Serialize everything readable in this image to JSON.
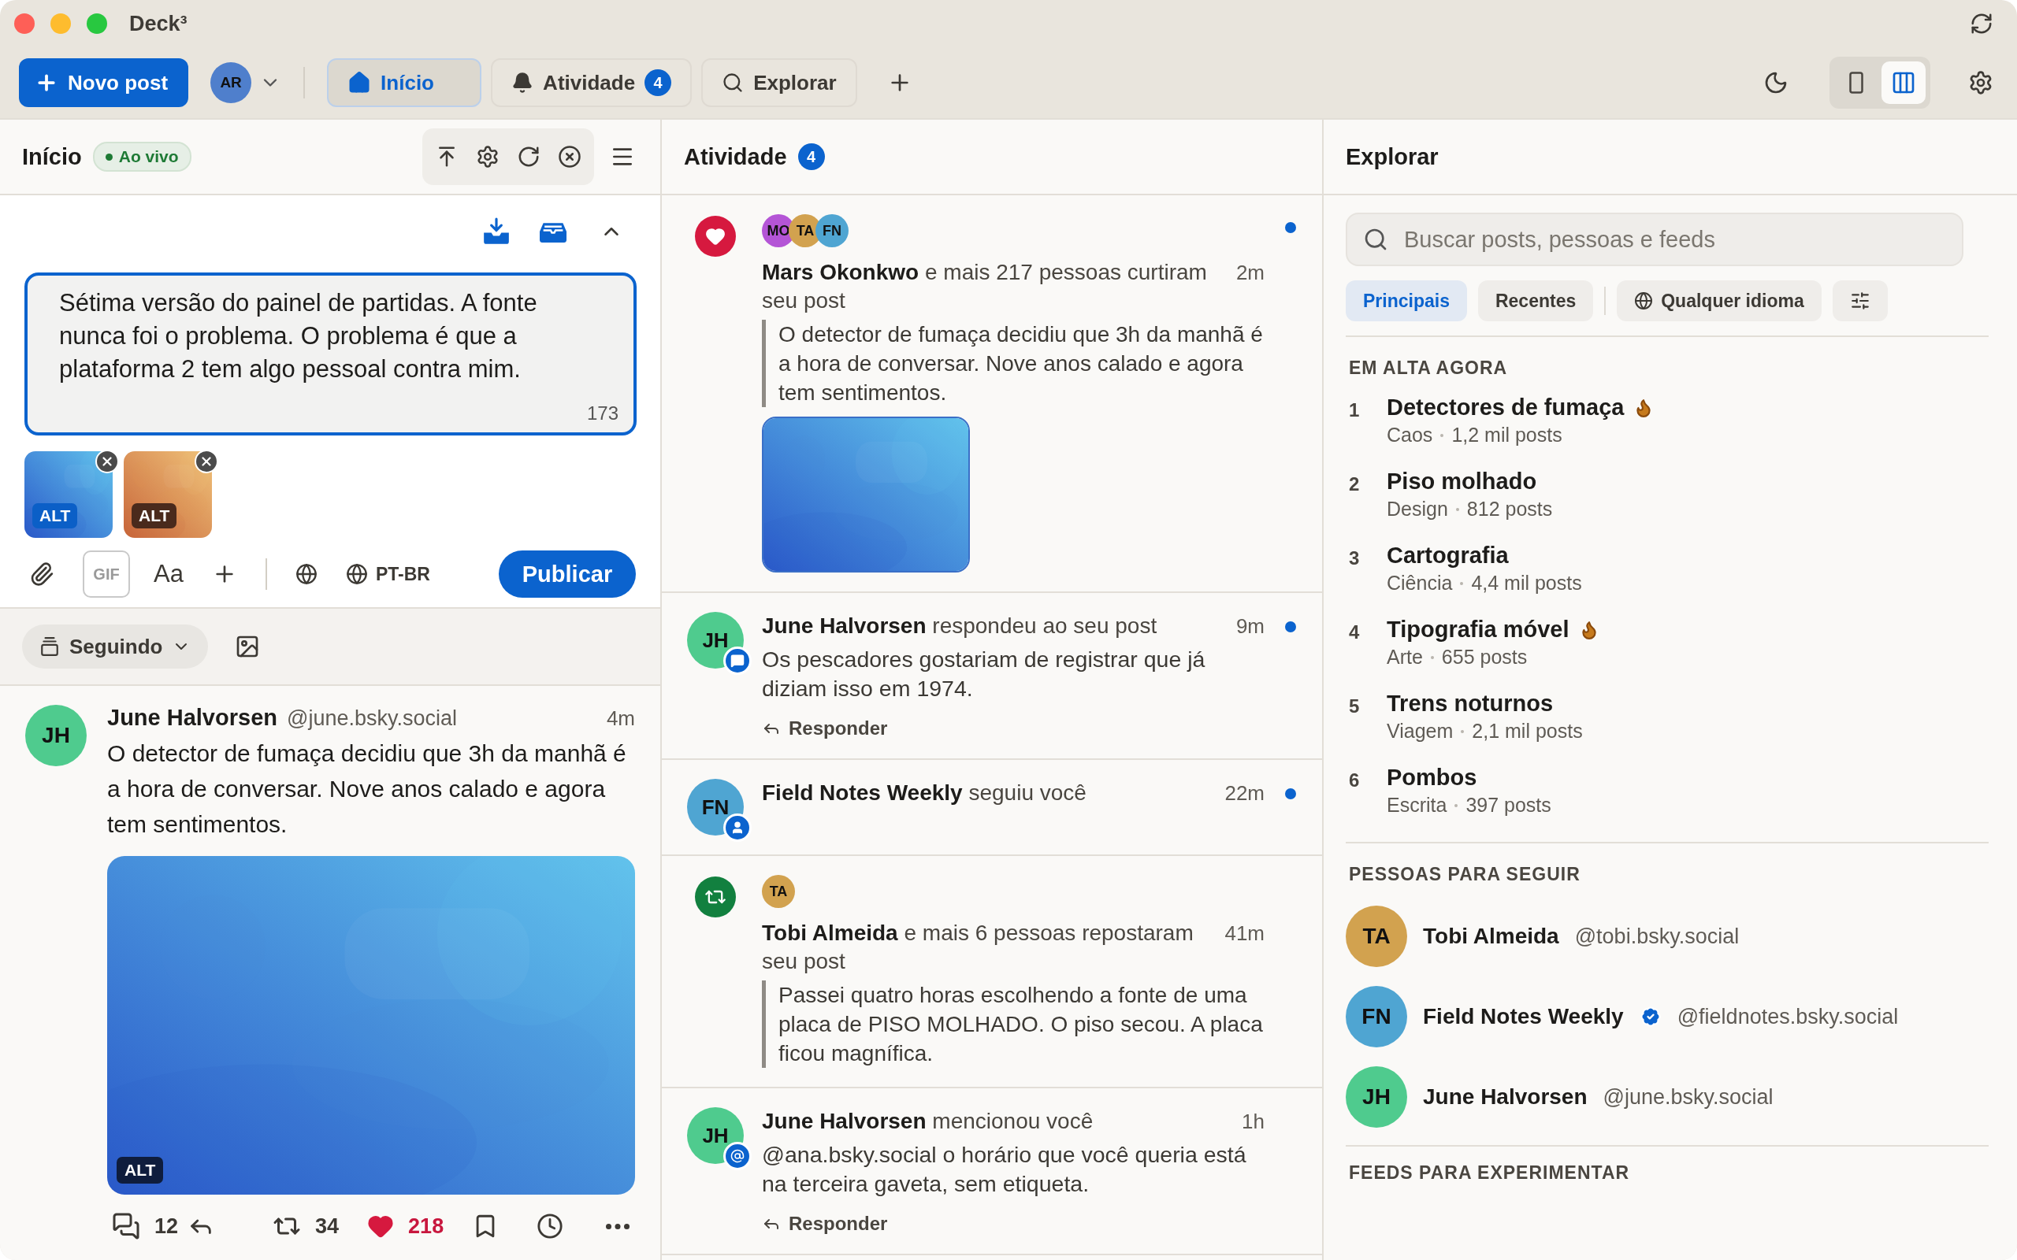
{
  "window": {
    "title": "Deck³"
  },
  "toolbar": {
    "new_post": "Novo post",
    "account": {
      "initials": "AR",
      "color": "#4f7fcc"
    },
    "tabs": [
      {
        "label": "Início",
        "selected": true
      },
      {
        "label": "Atividade",
        "badge": "4",
        "selected": false
      },
      {
        "label": "Explorar",
        "selected": false
      }
    ],
    "layouts": [
      {
        "kind": "single",
        "selected": false
      },
      {
        "kind": "columns",
        "selected": true
      }
    ]
  },
  "home": {
    "title": "Início",
    "live": "Ao vivo",
    "composer": {
      "value": "Sétima versão do painel de partidas. A fonte nunca foi o problema. O problema é que a plataforma 2 tem algo pessoal contra mim.",
      "count": "173",
      "attachments": [
        {
          "alt": "ALT",
          "color": "#0b5fc7"
        },
        {
          "alt": "ALT",
          "color": "#4a2a1c"
        }
      ],
      "gif": "GIF",
      "font": "Aa",
      "language": "PT-BR",
      "publish": "Publicar"
    },
    "filter": "Seguindo",
    "posts": [
      {
        "initials": "JH",
        "color": "#4fcb8e",
        "name": "June Halvorsen",
        "handle": "@june.bsky.social",
        "time": "4m",
        "text": "O detector de fumaça decidiu que 3h da manhã é a hora de conversar. Nove anos calado e agora tem sentimentos.",
        "image_alt": "ALT",
        "replies": "12",
        "reposts": "34",
        "likes": "218",
        "liked": true
      }
    ]
  },
  "activity": {
    "title": "Atividade",
    "badge": "4",
    "items": [
      {
        "kind": "like",
        "avatars": [
          {
            "initials": "MO",
            "color": "#b455d6"
          },
          {
            "initials": "TA",
            "color": "#d2a24f"
          },
          {
            "initials": "FN",
            "color": "#4fa5d2"
          }
        ],
        "title": "**Mars Okonkwo** e mais 217 pessoas curtiram seu post",
        "time": "2m",
        "unread": true,
        "quote": "O detector de fumaça decidiu que 3h da manhã é a hora de conversar. Nove anos calado e agora tem sentimentos."
      },
      {
        "kind": "reply",
        "avatars": [
          {
            "initials": "JH",
            "color": "#4fcb8e"
          }
        ],
        "title": "**June Halvorsen** respondeu ao seu post",
        "time": "9m",
        "unread": true,
        "text": "Os pescadores gostariam de registrar que já diziam isso em 1974.",
        "action": "Responder"
      },
      {
        "kind": "follow",
        "avatars": [
          {
            "initials": "FN",
            "color": "#4fa5d2"
          }
        ],
        "title": "**Field Notes Weekly** seguiu você",
        "time": "22m",
        "unread": true
      },
      {
        "kind": "repost",
        "avatars": [
          {
            "initials": "TA",
            "color": "#d2a24f"
          }
        ],
        "title": "**Tobi Almeida** e mais 6 pessoas repostaram seu post",
        "time": "41m",
        "unread": false,
        "quote": "Passei quatro horas escolhendo a fonte de uma placa de PISO MOLHADO. O piso secou. A placa ficou magnífica."
      },
      {
        "kind": "mention",
        "avatars": [
          {
            "initials": "JH",
            "color": "#4fcb8e"
          }
        ],
        "title": "**June Halvorsen** mencionou você",
        "time": "1h",
        "unread": false,
        "text": "@ana.bsky.social o horário que você queria está na terceira gaveta, sem etiqueta.",
        "action": "Responder"
      }
    ]
  },
  "explore": {
    "title": "Explorar",
    "search": {
      "placeholder": "Buscar posts, pessoas e feeds"
    },
    "filters": [
      {
        "label": "Principais",
        "selected": true
      },
      {
        "label": "Recentes",
        "selected": false
      }
    ],
    "language": "Qualquer idioma",
    "trending": {
      "heading": "EM ALTA AGORA",
      "items": [
        {
          "rank": "1",
          "topic": "Detectores de fumaça",
          "hot": true,
          "category": "Caos",
          "count": "1,2 mil posts"
        },
        {
          "rank": "2",
          "topic": "Piso molhado",
          "hot": false,
          "category": "Design",
          "count": "812 posts"
        },
        {
          "rank": "3",
          "topic": "Cartografia",
          "hot": false,
          "category": "Ciência",
          "count": "4,4 mil posts"
        },
        {
          "rank": "4",
          "topic": "Tipografia móvel",
          "hot": true,
          "category": "Arte",
          "count": "655 posts"
        },
        {
          "rank": "5",
          "topic": "Trens noturnos",
          "hot": false,
          "category": "Viagem",
          "count": "2,1 mil posts"
        },
        {
          "rank": "6",
          "topic": "Pombos",
          "hot": false,
          "category": "Escrita",
          "count": "397 posts"
        }
      ]
    },
    "people": {
      "heading": "PESSOAS PARA SEGUIR",
      "items": [
        {
          "initials": "TA",
          "color": "#d2a24f",
          "name": "Tobi Almeida",
          "verified": false,
          "handle": "@tobi.bsky.social"
        },
        {
          "initials": "FN",
          "color": "#4fa5d2",
          "name": "Field Notes Weekly",
          "verified": true,
          "handle": "@fieldnotes.bsky.social"
        },
        {
          "initials": "JH",
          "color": "#4fcb8e",
          "name": "June Halvorsen",
          "verified": false,
          "handle": "@june.bsky.social"
        }
      ]
    },
    "feeds": {
      "heading": "FEEDS PARA EXPERIMENTAR"
    }
  }
}
